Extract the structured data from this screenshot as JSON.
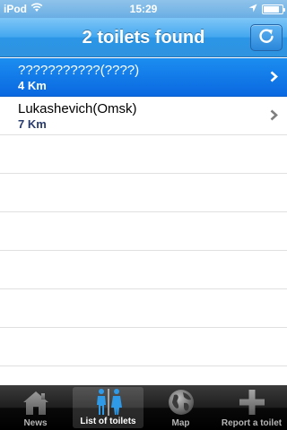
{
  "status_bar": {
    "carrier": "iPod",
    "time": "15:29",
    "battery_level": 0.85
  },
  "nav": {
    "title": "2 toilets found"
  },
  "list": {
    "items": [
      {
        "name": "???????????(????)",
        "distance": "4 Km",
        "selected": true
      },
      {
        "name": "Lukashevich(Omsk)",
        "distance": "7 Km",
        "selected": false
      }
    ]
  },
  "tabs": [
    {
      "label": "News",
      "icon": "house-icon",
      "active": false
    },
    {
      "label": "List of toilets",
      "icon": "restroom-icon",
      "active": true
    },
    {
      "label": "Map",
      "icon": "globe-icon",
      "active": false
    },
    {
      "label": "Report a toilet",
      "icon": "plus-icon",
      "active": false
    }
  ],
  "colors": {
    "nav_blue": "#2f94e0",
    "selected_row": "#0a68e0",
    "distance_text": "#2a3c6e"
  }
}
